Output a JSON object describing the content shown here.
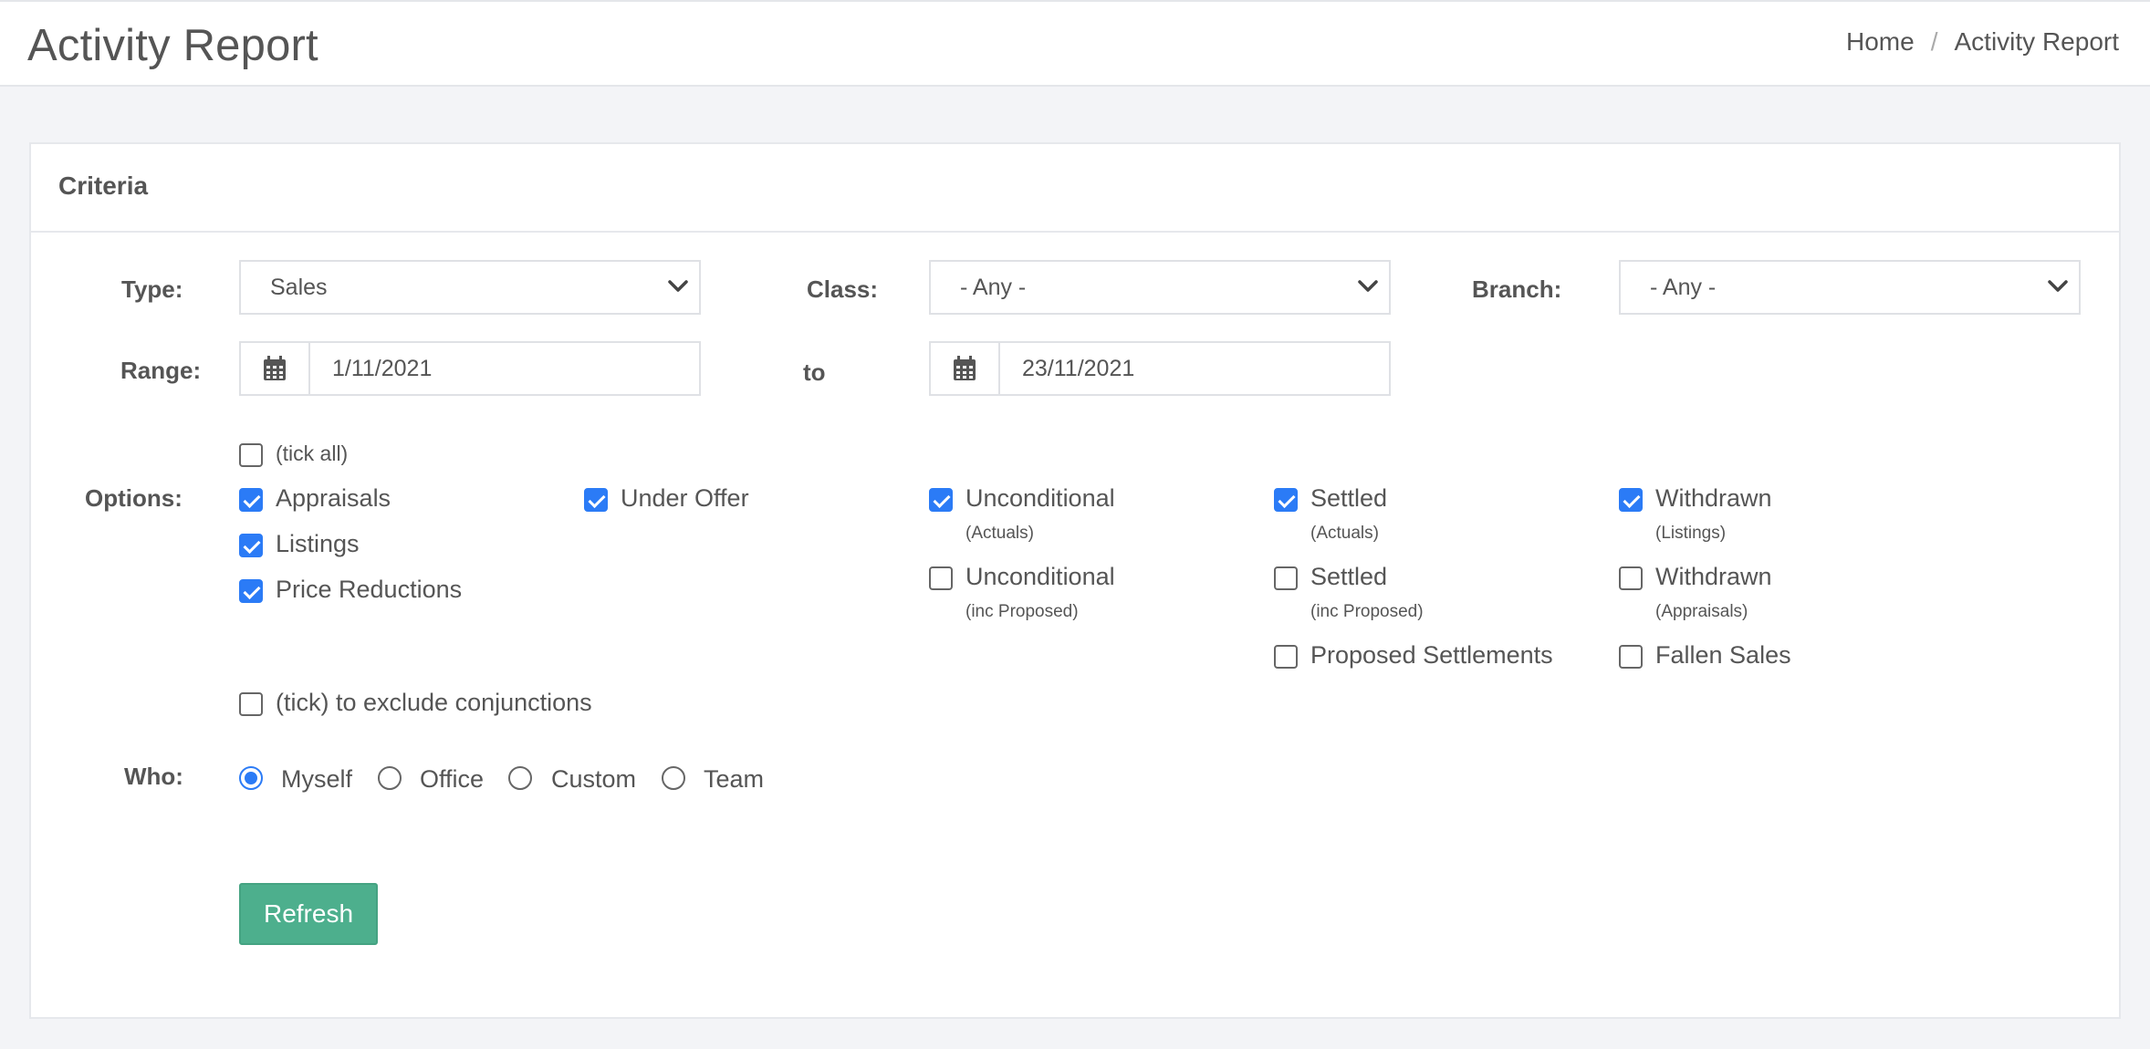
{
  "header": {
    "title": "Activity Report",
    "breadcrumb": {
      "home": "Home",
      "separator": "/",
      "current": "Activity Report"
    }
  },
  "criteria": {
    "title": "Criteria",
    "type": {
      "label": "Type:",
      "value": "Sales"
    },
    "class": {
      "label": "Class:",
      "value": "- Any -"
    },
    "branch": {
      "label": "Branch:",
      "value": "- Any -"
    },
    "range": {
      "label": "Range:",
      "from": "1/11/2021",
      "to_label": "to",
      "to": "23/11/2021"
    },
    "options": {
      "label": "Options:",
      "tick_all": {
        "label": "(tick all)",
        "checked": false
      },
      "items": {
        "appraisals": {
          "label": "Appraisals",
          "checked": true
        },
        "listings": {
          "label": "Listings",
          "checked": true
        },
        "price_reductions": {
          "label": "Price Reductions",
          "checked": true
        },
        "under_offer": {
          "label": "Under Offer",
          "checked": true
        },
        "unconditional_actuals": {
          "label": "Unconditional",
          "sub": "(Actuals)",
          "checked": true
        },
        "unconditional_proposed": {
          "label": "Unconditional",
          "sub": "(inc Proposed)",
          "checked": false
        },
        "settled_actuals": {
          "label": "Settled",
          "sub": "(Actuals)",
          "checked": true
        },
        "settled_proposed": {
          "label": "Settled",
          "sub": "(inc Proposed)",
          "checked": false
        },
        "proposed_settlements": {
          "label": "Proposed Settlements",
          "checked": false
        },
        "withdrawn_listings": {
          "label": "Withdrawn",
          "sub": "(Listings)",
          "checked": true
        },
        "withdrawn_appraisals": {
          "label": "Withdrawn",
          "sub": "(Appraisals)",
          "checked": false
        },
        "fallen_sales": {
          "label": "Fallen Sales",
          "checked": false
        }
      },
      "exclude_conjunctions": {
        "label": "(tick) to exclude conjunctions",
        "checked": false
      }
    },
    "who": {
      "label": "Who:",
      "selected": "Myself",
      "options": [
        "Myself",
        "Office",
        "Custom",
        "Team"
      ]
    },
    "refresh_label": "Refresh"
  },
  "colors": {
    "accent": "#2b7bf6",
    "button": "#4daf8d"
  },
  "icons": {
    "calendar": "calendar-icon",
    "chevron": "chevron-down-icon"
  }
}
